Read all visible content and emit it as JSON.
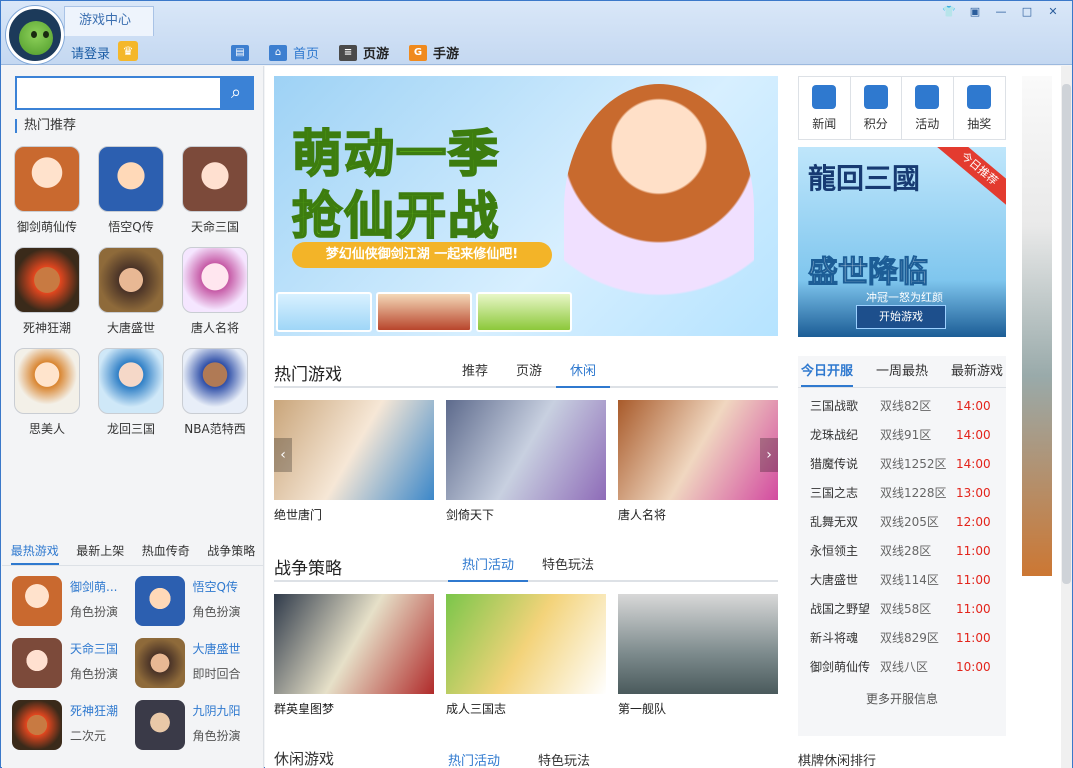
{
  "window": {
    "tab_title": "游戏中心",
    "login_label": "请登录",
    "controls": [
      "shirt-icon",
      "restore-icon",
      "minimize-icon",
      "maximize-icon",
      "close-icon"
    ]
  },
  "nav": [
    {
      "label": "首页",
      "active": true,
      "icon": "home-icon"
    },
    {
      "label": "页游",
      "icon": "web-game-icon"
    },
    {
      "label": "手游",
      "icon": "mobile-game-icon"
    }
  ],
  "search": {
    "placeholder": ""
  },
  "left": {
    "hot_label": "热门推荐",
    "games": [
      "御剑萌仙传",
      "悟空Q传",
      "天命三国",
      "死神狂潮",
      "大唐盛世",
      "唐人名将",
      "思美人",
      "龙回三国",
      "NBA范特西"
    ],
    "tabs": [
      "最热游戏",
      "最新上架",
      "热血传奇",
      "战争策略"
    ],
    "list": [
      {
        "name": "御剑萌...",
        "type": "角色扮演"
      },
      {
        "name": "悟空Q传",
        "type": "角色扮演"
      },
      {
        "name": "天命三国",
        "type": "角色扮演"
      },
      {
        "name": "大唐盛世",
        "type": "即时回合"
      },
      {
        "name": "死神狂潮",
        "type": "二次元"
      },
      {
        "name": "九阴九阳",
        "type": "角色扮演"
      }
    ]
  },
  "banner": {
    "line1": "萌动一季",
    "line2": "抢仙开战",
    "ribbon": "梦幻仙侠御剑江湖 一起来修仙吧!"
  },
  "quick": [
    "新闻",
    "积分",
    "活动",
    "抽奖"
  ],
  "sidead": {
    "tag": "今日推荐",
    "title": "龍回三國",
    "headline": "盛世降临",
    "sub": "冲冠一怒为红颜",
    "button": "开始游戏"
  },
  "sections": [
    {
      "title": "热门游戏",
      "tabs": [
        "推荐",
        "页游",
        "休闲"
      ],
      "active": 2,
      "games": [
        "绝世唐门",
        "剑倚天下",
        "唐人名将"
      ]
    },
    {
      "title": "战争策略",
      "tabs": [
        "热门活动",
        "特色玩法"
      ],
      "active": 0,
      "games": [
        "群英皇图梦",
        "成人三国志",
        "第一舰队"
      ]
    }
  ],
  "bottom": {
    "title": "休闲游戏",
    "tabs": [
      "热门活动",
      "特色玩法"
    ],
    "right": "棋牌休闲排行"
  },
  "servers": {
    "tabs": [
      "今日开服",
      "一周最热",
      "最新游戏"
    ],
    "rows": [
      [
        "三国战歌",
        "双线82区",
        "14:00"
      ],
      [
        "龙珠战纪",
        "双线91区",
        "14:00"
      ],
      [
        "猎魔传说",
        "双线1252区",
        "14:00"
      ],
      [
        "三国之志",
        "双线1228区",
        "13:00"
      ],
      [
        "乱舞无双",
        "双线205区",
        "12:00"
      ],
      [
        "永恒领主",
        "双线28区",
        "11:00"
      ],
      [
        "大唐盛世",
        "双线114区",
        "11:00"
      ],
      [
        "战国之野望",
        "双线58区",
        "11:00"
      ],
      [
        "新斗将魂",
        "双线829区",
        "11:00"
      ],
      [
        "御剑萌仙传",
        "双线八区",
        "10:00"
      ]
    ],
    "more": "更多开服信息"
  },
  "colors": {
    "accent": "#2f79cf",
    "time": "#e3241b"
  }
}
